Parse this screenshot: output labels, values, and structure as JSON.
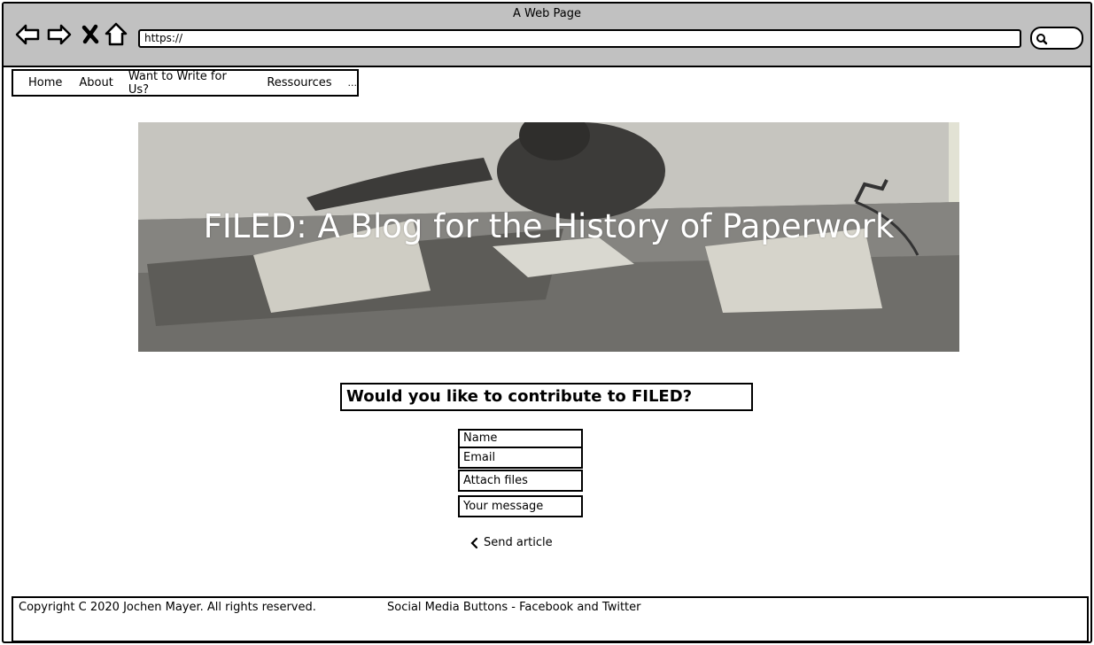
{
  "window": {
    "title": "A Web Page"
  },
  "toolbar": {
    "url": "https://",
    "icons": [
      "back-arrow-icon",
      "forward-arrow-icon",
      "close-x-icon",
      "home-icon",
      "search-icon"
    ]
  },
  "menu": {
    "items": [
      {
        "label": "Home"
      },
      {
        "label": "About"
      },
      {
        "label": "Want to Write for Us?"
      },
      {
        "label": "Ressources"
      },
      {
        "label": "..."
      }
    ]
  },
  "hero": {
    "title": "FILED: A Blog for the History of Paperwork"
  },
  "form": {
    "heading": "Would you like to contribute to FILED?",
    "fields": [
      {
        "label": "Name"
      },
      {
        "label": "Email"
      },
      {
        "label": "Attach files"
      },
      {
        "label": "Your message"
      }
    ],
    "send_label": "Send article"
  },
  "footer": {
    "copyright": "Copyright C 2020 Jochen Mayer. All rights reserved.",
    "social": "Social Media Buttons - Facebook and Twitter"
  },
  "colors": {
    "titlebar": "#c1c1c1",
    "border": "#000000",
    "hero_text": "#ffffff"
  }
}
